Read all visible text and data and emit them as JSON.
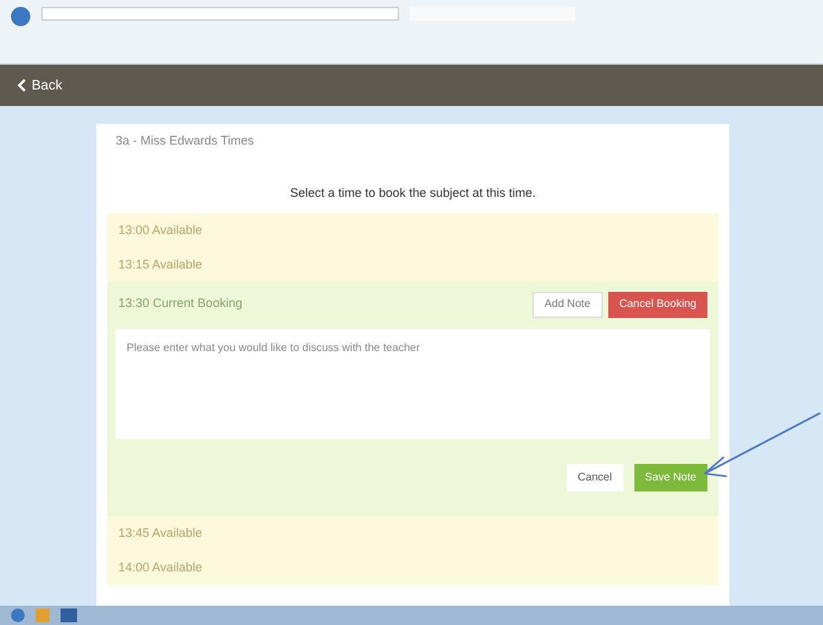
{
  "toolbar": {
    "back": "Back"
  },
  "subject_title": "3a - Miss Edwards Times",
  "instruction": "Select a time to book the subject at this time.",
  "slots": [
    {
      "time": "13:00",
      "status": "Available",
      "kind": "available"
    },
    {
      "time": "13:15",
      "status": "Available",
      "kind": "available"
    },
    {
      "time": "13:30",
      "status": "Current Booking",
      "kind": "booking",
      "add_note": "Add Note",
      "cancel_booking": "Cancel Booking",
      "note": {
        "placeholder": "Please enter what you would like to discuss with the teacher",
        "cancel": "Cancel",
        "save": "Save Note"
      }
    },
    {
      "time": "13:45",
      "status": "Available",
      "kind": "available"
    },
    {
      "time": "14:00",
      "status": "Available",
      "kind": "available"
    }
  ]
}
